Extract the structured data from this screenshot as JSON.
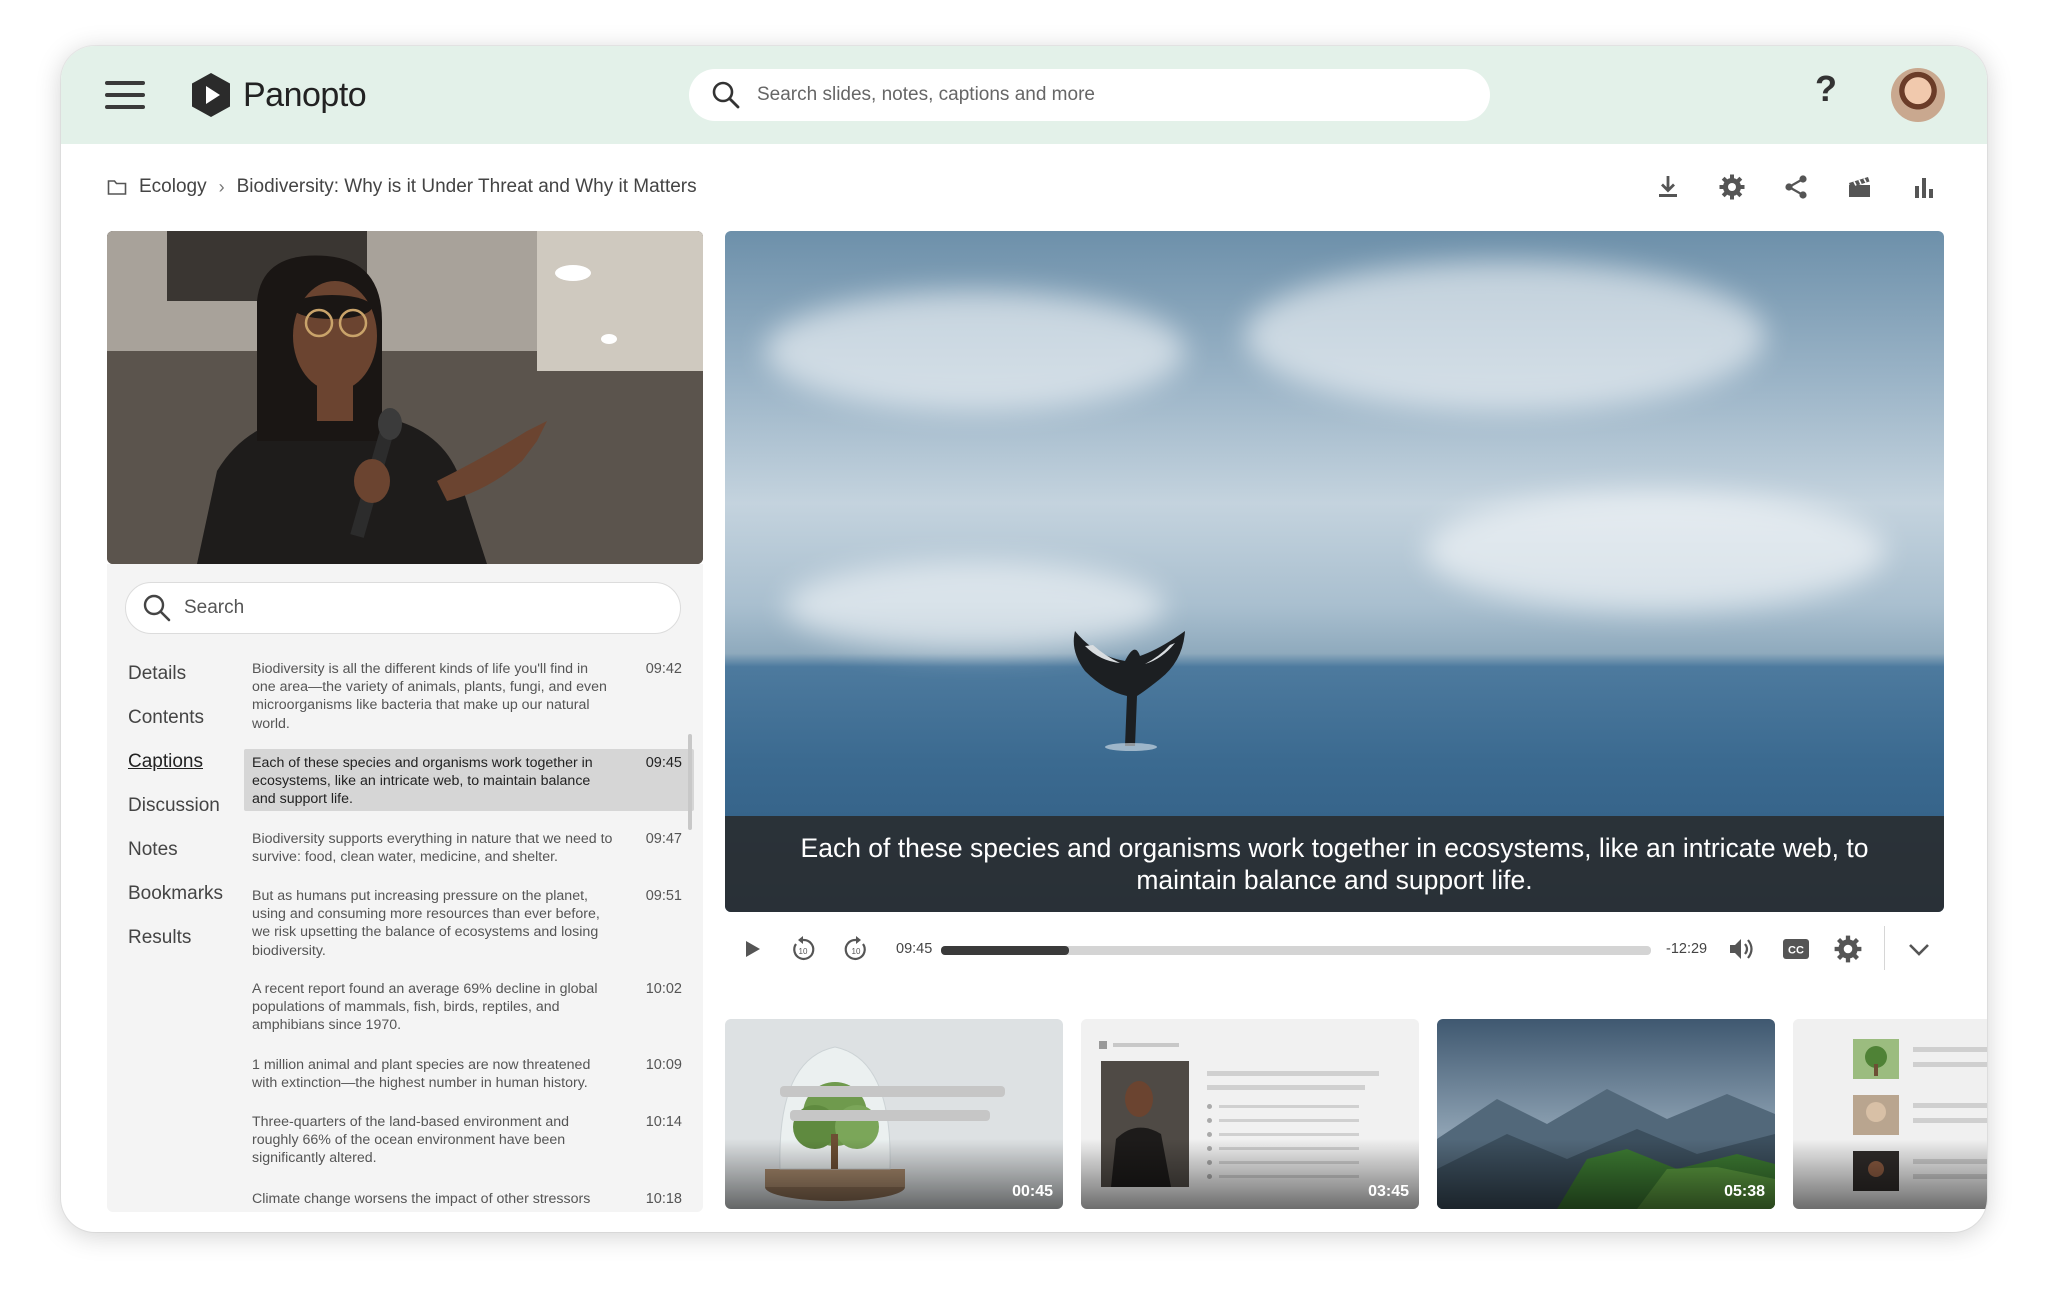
{
  "app": {
    "name": "Panopto"
  },
  "header": {
    "search_placeholder": "Search slides, notes, captions and more",
    "help_label": "?"
  },
  "breadcrumb": {
    "folder": "Ecology",
    "title": "Biodiversity: Why is it Under Threat and Why it Matters"
  },
  "toolbar": {
    "icons": [
      "download-icon",
      "gear-icon",
      "share-icon",
      "clapperboard-icon",
      "bar-chart-icon"
    ]
  },
  "left_panel": {
    "search_placeholder": "Search",
    "nav": [
      {
        "label": "Details"
      },
      {
        "label": "Contents"
      },
      {
        "label": "Captions",
        "active": true
      },
      {
        "label": "Discussion"
      },
      {
        "label": "Notes"
      },
      {
        "label": "Bookmarks"
      },
      {
        "label": "Results"
      }
    ],
    "captions": [
      {
        "text": "Biodiversity is all the different kinds of life you'll find in one area—the variety of animals, plants, fungi, and even microorganisms like bacteria that make up our natural world.",
        "time": "09:42"
      },
      {
        "text": "Each of these species and organisms work together in ecosystems, like an intricate web, to maintain balance and support life.",
        "time": "09:45",
        "active": true
      },
      {
        "text": "Biodiversity supports everything in nature that we need to survive: food, clean water, medicine, and shelter.",
        "time": "09:47"
      },
      {
        "text": "But as humans put increasing pressure on the planet, using and consuming more resources than ever before, we risk upsetting the balance of ecosystems and losing biodiversity.",
        "time": "09:51"
      },
      {
        "text": "A recent report found an average 69% decline in global populations of mammals, fish, birds, reptiles, and amphibians since 1970.",
        "time": "10:02"
      },
      {
        "text": "1 million animal and plant species are now threatened with extinction—the highest number in human history.",
        "time": "10:09"
      },
      {
        "text": "Three-quarters of the land-based environment and roughly 66% of the ocean environment have been significantly altered.",
        "time": "10:14"
      },
      {
        "text": "Climate change worsens the impact of other stressors",
        "time": "10:18"
      }
    ]
  },
  "player": {
    "caption_text": "Each of these species and organisms work together in ecosystems, like an intricate web, to maintain balance and support life.",
    "current_time": "09:45",
    "remaining_time": "-12:29",
    "progress": 0.18,
    "cc_label": "CC"
  },
  "thumbnails": [
    {
      "duration": "00:45",
      "icon": "tree-terrarium-thumbnail"
    },
    {
      "duration": "03:45",
      "icon": "slide-with-speaker-thumbnail"
    },
    {
      "duration": "05:38",
      "icon": "misty-mountains-thumbnail"
    },
    {
      "duration": "",
      "icon": "slide-list-thumbnail"
    }
  ]
}
